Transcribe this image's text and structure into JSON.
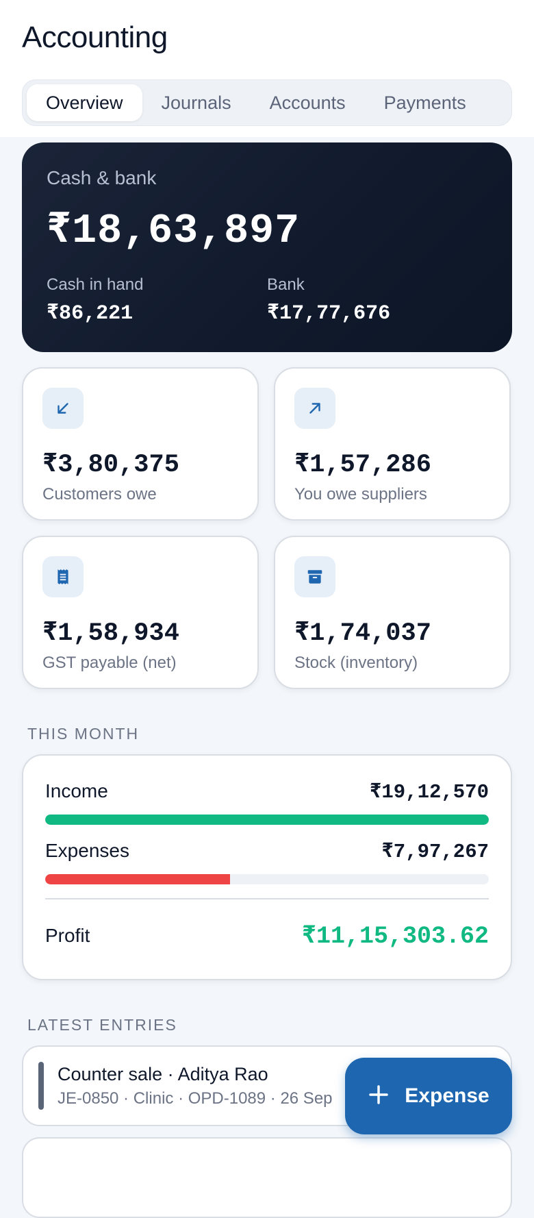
{
  "header": {
    "title": "Accounting",
    "tabs": [
      {
        "label": "Overview",
        "active": true
      },
      {
        "label": "Journals"
      },
      {
        "label": "Accounts"
      },
      {
        "label": "Payments"
      }
    ]
  },
  "cash_card": {
    "label": "Cash & bank",
    "total": "₹18,63,897",
    "cash_in_hand_label": "Cash in hand",
    "cash_in_hand_value": "₹86,221",
    "bank_label": "Bank",
    "bank_value": "₹17,77,676"
  },
  "stats": [
    {
      "value": "₹3,80,375",
      "label": "Customers owe",
      "icon": "arrow-down-left-icon"
    },
    {
      "value": "₹1,57,286",
      "label": "You owe suppliers",
      "icon": "arrow-up-right-icon"
    },
    {
      "value": "₹1,58,934",
      "label": "GST payable (net)",
      "icon": "receipt-icon"
    },
    {
      "value": "₹1,74,037",
      "label": "Stock (inventory)",
      "icon": "archive-icon"
    }
  ],
  "this_month": {
    "section_title": "THIS MONTH",
    "income_label": "Income",
    "income_value": "₹19,12,570",
    "income_fraction": 1.0,
    "expenses_label": "Expenses",
    "expenses_value": "₹7,97,267",
    "expenses_fraction": 0.417,
    "profit_label": "Profit",
    "profit_value": "₹11,15,303.62"
  },
  "latest_entries": {
    "section_title": "LATEST ENTRIES",
    "items": [
      {
        "title": "Counter sale · Aditya Rao",
        "subtitle": "JE-0850 · Clinic · OPD-1089 · 26 Sep"
      }
    ]
  },
  "fab": {
    "label": "Expense",
    "icon": "plus-icon"
  },
  "colors": {
    "accent": "#1e66b0",
    "income": "#10b981",
    "expense": "#ef4444",
    "profit": "#10b981",
    "dark_card": "#101a2c"
  }
}
